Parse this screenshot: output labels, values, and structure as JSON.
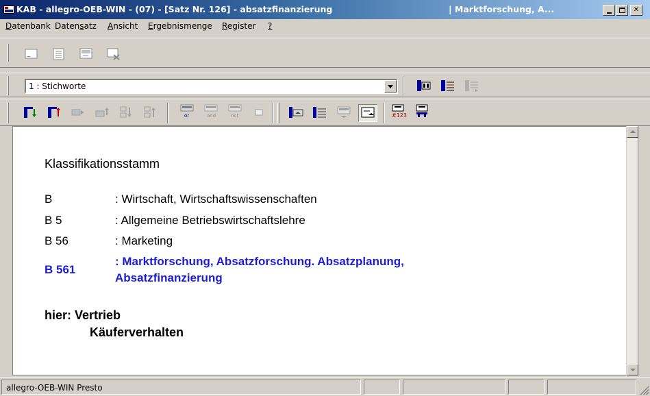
{
  "window": {
    "title": "KAB - allegro-OEB-WIN - (07) - [Satz Nr. 126] - absatzfinanzierung",
    "title_right": "| Marktforschung, A...",
    "title_bar_color": "#0a246a"
  },
  "menu": [
    {
      "label": "Datenbank",
      "accel": "D"
    },
    {
      "label": "Datensatz",
      "accel": "s"
    },
    {
      "label": "Ansicht",
      "accel": "A"
    },
    {
      "label": "Ergebnismenge",
      "accel": "E"
    },
    {
      "label": "Register",
      "accel": "R"
    },
    {
      "label": "?",
      "accel": "?"
    }
  ],
  "toolbar1": {
    "icons": [
      "new-record-icon",
      "list-view-icon",
      "edit-record-icon",
      "delete-record-icon"
    ]
  },
  "toolbar2": {
    "index_combo_value": "1 : Stichworte",
    "icons": [
      "index-search-icon",
      "index-list-icon",
      "index-browse-icon"
    ]
  },
  "toolbar3": {
    "labels": {
      "or": "or",
      "and": "and",
      "not": "not",
      "number": "#123"
    },
    "icons": [
      "sort-down-icon",
      "sort-up-icon",
      "move-right-icon",
      "move-up-icon",
      "sort-a-icon",
      "sort-b-icon",
      "set-or-icon",
      "set-and-icon",
      "set-not-icon",
      "set-empty-icon",
      "display-list-icon",
      "display-full-icon",
      "display-short-icon",
      "display-window-icon",
      "record-number-icon",
      "key-icon"
    ]
  },
  "document": {
    "heading": "Klassifikationsstamm",
    "rows": [
      {
        "code": "B",
        "text": ": Wirtschaft, Wirtschaftswissenschaften"
      },
      {
        "code": "B 5",
        "text": ": Allgemeine Betriebswirtschaftslehre"
      },
      {
        "code": "B 56",
        "text": ": Marketing"
      }
    ],
    "highlight": {
      "code": "B 561",
      "line1": ": Marktforschung, Absatzforschung. Absatzplanung,",
      "line2": "Absatzfinanzierung",
      "color": "#1c1cd8"
    },
    "hier_label": "hier: Vertrieb",
    "hier_sub": "Käuferverhalten"
  },
  "status": {
    "text": "allegro-OEB-WIN Presto"
  }
}
